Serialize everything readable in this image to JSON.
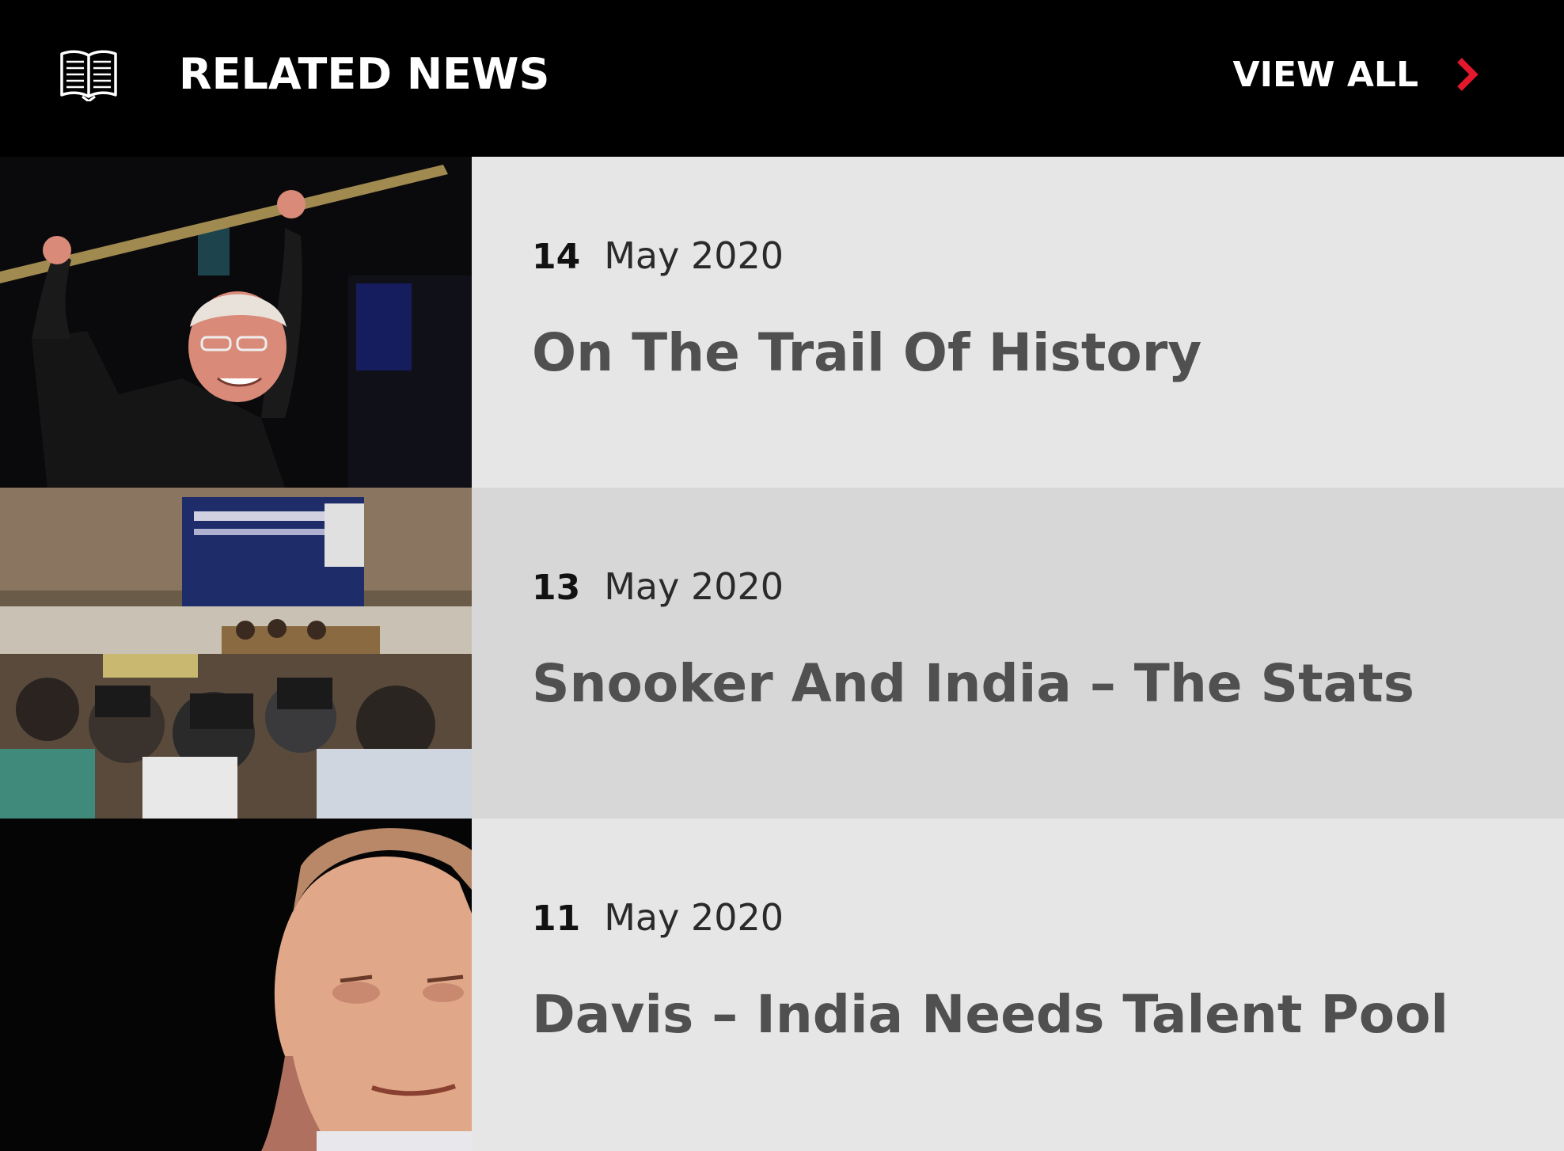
{
  "header": {
    "title": "RELATED NEWS",
    "view_all_label": "VIEW ALL",
    "icon": "open-book-icon",
    "chevron_icon": "chevron-right-icon",
    "accent_color": "#e3182d"
  },
  "articles": [
    {
      "day": "14",
      "month_year": "May 2020",
      "title": "On The Trail Of History"
    },
    {
      "day": "13",
      "month_year": "May 2020",
      "title": "Snooker And India – The Stats"
    },
    {
      "day": "11",
      "month_year": "May 2020",
      "title": "Davis – India Needs Talent Pool"
    }
  ]
}
